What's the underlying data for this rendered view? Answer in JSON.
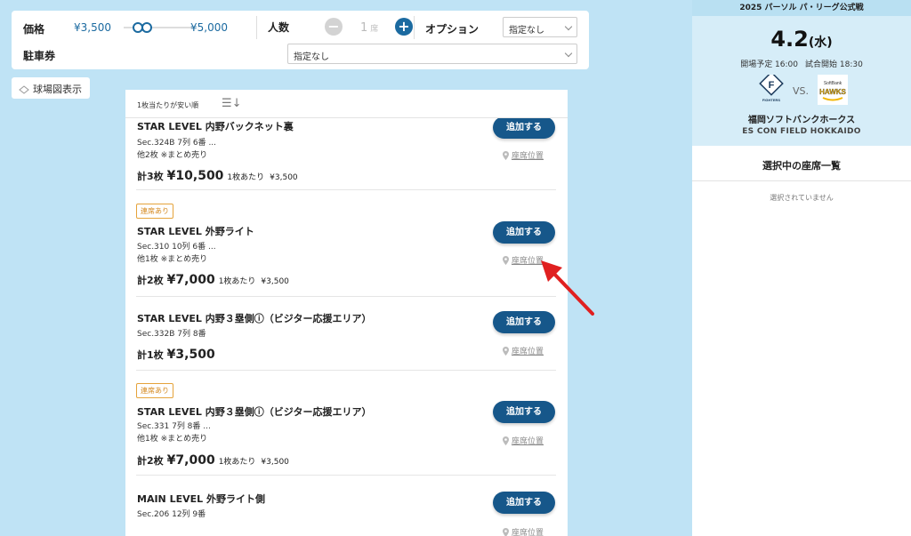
{
  "filters": {
    "price_label": "価格",
    "price_min": "¥3,500",
    "price_max": "¥5,000",
    "people_label": "人数",
    "people_count": "1",
    "people_unit": "席",
    "minus_symbol": "−",
    "plus_symbol": "+",
    "option_label": "オプション",
    "option_value": "指定なし",
    "parking_label": "駐車券",
    "parking_value": "指定なし"
  },
  "map_button": {
    "label": "球場図表示"
  },
  "sort": {
    "label": "1枚当たりが安い順",
    "icon": "sort-icon"
  },
  "tickets": [
    {
      "badge": "",
      "title": "STAR LEVEL 内野バックネット裏",
      "sec": "Sec.324B 7列 6番 ...",
      "note": "他2枚 ※まとめ売り",
      "count": "計3枚",
      "price": "¥10,500",
      "per_label": "1枚あたり",
      "per_price": "¥3,500",
      "add": "追加する",
      "seat": "座席位置"
    },
    {
      "badge": "連席あり",
      "title": "STAR LEVEL 外野ライト",
      "sec": "Sec.310 10列 6番 ...",
      "note": "他1枚 ※まとめ売り",
      "count": "計2枚",
      "price": "¥7,000",
      "per_label": "1枚あたり",
      "per_price": "¥3,500",
      "add": "追加する",
      "seat": "座席位置"
    },
    {
      "badge": "",
      "title": "STAR LEVEL 内野３塁側ⓘ（ビジター応援エリア）",
      "sec": "Sec.332B 7列 8番",
      "note": "",
      "count": "計1枚",
      "price": "¥3,500",
      "per_label": "",
      "per_price": "",
      "add": "追加する",
      "seat": "座席位置"
    },
    {
      "badge": "連席あり",
      "title": "STAR LEVEL 内野３塁側ⓘ（ビジター応援エリア）",
      "sec": "Sec.331 7列 8番 ...",
      "note": "他1枚 ※まとめ売り",
      "count": "計2枚",
      "price": "¥7,000",
      "per_label": "1枚あたり",
      "per_price": "¥3,500",
      "add": "追加する",
      "seat": "座席位置"
    },
    {
      "badge": "",
      "title": "MAIN LEVEL 外野ライト側",
      "sec": "Sec.206 12列 9番",
      "note": "",
      "count": "",
      "price": "",
      "per_label": "",
      "per_price": "",
      "add": "追加する",
      "seat": "座席位置"
    }
  ],
  "event": {
    "league": "2025 パーソル パ・リーグ公式戦",
    "date": "4.2",
    "weekday": "(水)",
    "open_time": "開場予定 16:00",
    "start_time": "試合開始 18:30",
    "home_logo_text": "FIGHTERS",
    "vs": "VS.",
    "away_logo_top": "SoftBank",
    "away_logo_text": "HAWKS",
    "opponent": "福岡ソフトバンクホークス",
    "venue": "ES CON FIELD HOKKAIDO"
  },
  "selection": {
    "title": "選択中の座席一覧",
    "empty": "選択されていません"
  },
  "colors": {
    "page_bg": "#bfe3f5",
    "accent": "#1b6aa0",
    "add_button": "#16578a",
    "badge": "#d4881e",
    "arrow": "#e02020"
  }
}
